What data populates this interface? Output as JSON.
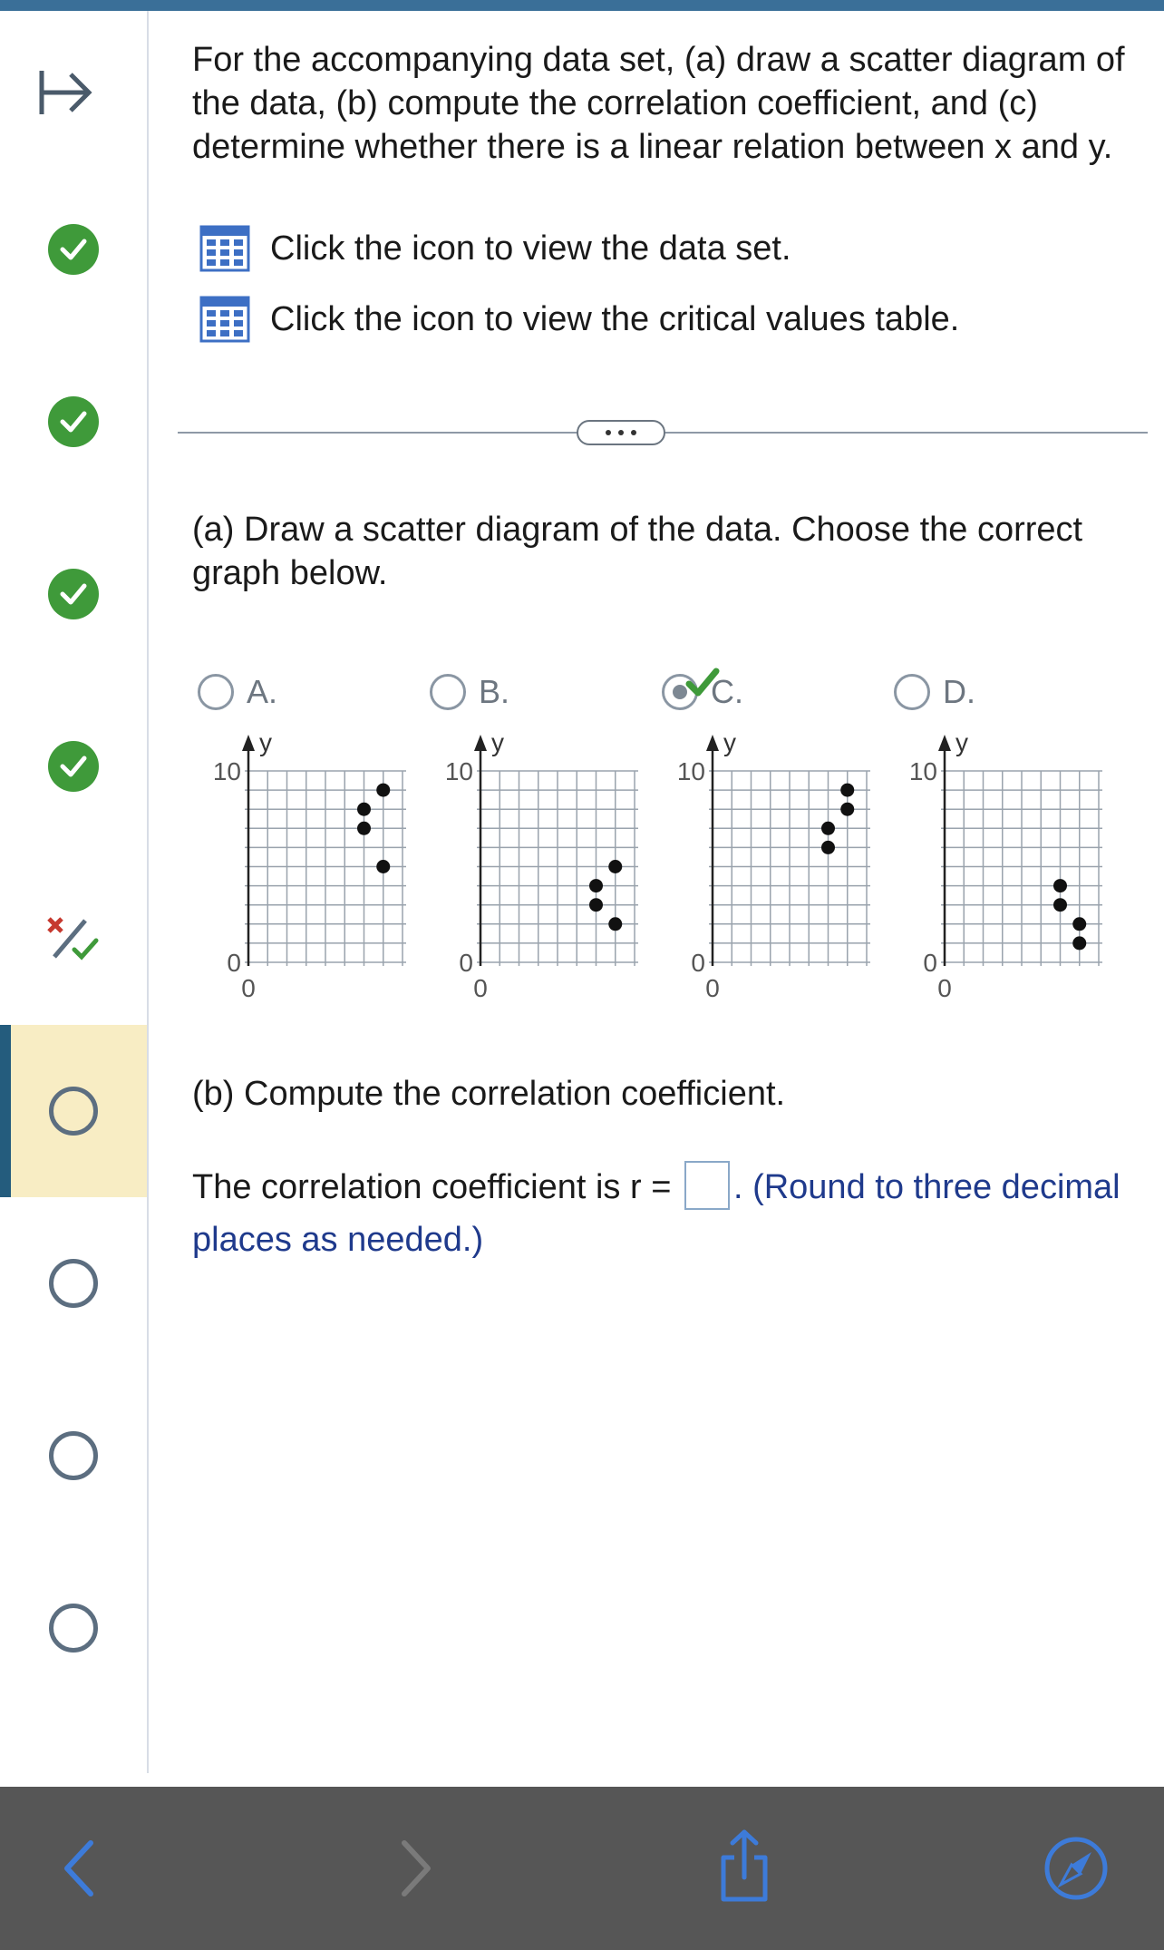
{
  "sidebar": {
    "items": [
      {
        "status": "complete"
      },
      {
        "status": "complete"
      },
      {
        "status": "complete"
      },
      {
        "status": "complete"
      },
      {
        "status": "partial"
      },
      {
        "status": "current"
      },
      {
        "status": "unanswered"
      },
      {
        "status": "unanswered"
      },
      {
        "status": "unanswered"
      }
    ],
    "colors": {
      "check": "#3f9a3a",
      "active_bg": "#f8edc4",
      "active_bar": "#245c7d"
    }
  },
  "question": {
    "prompt": "For the accompanying data set, (a) draw a scatter diagram of the data, (b) compute the correlation coefficient, and (c) determine whether there is a linear relation between x and y.",
    "data_set_link": "Click the icon to view the data set.",
    "critical_values_link": "Click the icon to view the critical values table."
  },
  "part_a": {
    "text": "(a) Draw a scatter diagram of the data. Choose the correct graph below.",
    "options": [
      {
        "label": "A.",
        "selected": false
      },
      {
        "label": "B.",
        "selected": false
      },
      {
        "label": "C.",
        "selected": true
      },
      {
        "label": "D.",
        "selected": false
      }
    ]
  },
  "part_b": {
    "text": "(b) Compute the correlation coefficient.",
    "answer_prefix": "The correlation coefficient is r =",
    "answer_value": "",
    "answer_suffix": ". (Round to three decimal places as needed.)"
  },
  "chart_data": [
    {
      "type": "scatter",
      "xlabel": "",
      "ylabel": "y",
      "ylim": [
        0,
        10
      ],
      "x_tick": "0",
      "y_ticks": [
        "0",
        "10"
      ],
      "x": [
        6,
        6,
        7,
        7
      ],
      "y": [
        7,
        8,
        9,
        5
      ]
    },
    {
      "type": "scatter",
      "xlabel": "",
      "ylabel": "y",
      "ylim": [
        0,
        10
      ],
      "x_tick": "0",
      "y_ticks": [
        "0",
        "10"
      ],
      "x": [
        6,
        6,
        7,
        7
      ],
      "y": [
        3,
        4,
        5,
        2
      ]
    },
    {
      "type": "scatter",
      "xlabel": "",
      "ylabel": "y",
      "ylim": [
        0,
        10
      ],
      "x_tick": "0",
      "y_ticks": [
        "0",
        "10"
      ],
      "x": [
        6,
        6,
        7,
        7
      ],
      "y": [
        6,
        7,
        9,
        8
      ]
    },
    {
      "type": "scatter",
      "xlabel": "",
      "ylabel": "y",
      "ylim": [
        0,
        10
      ],
      "x_tick": "0",
      "y_ticks": [
        "0",
        "10"
      ],
      "x": [
        6,
        6,
        7,
        7
      ],
      "y": [
        4,
        3,
        2,
        1
      ]
    }
  ],
  "bottom_bar": {
    "back": "back-chevron-icon",
    "forward": "forward-chevron-icon",
    "share": "share-icon",
    "browser": "compass-icon"
  }
}
